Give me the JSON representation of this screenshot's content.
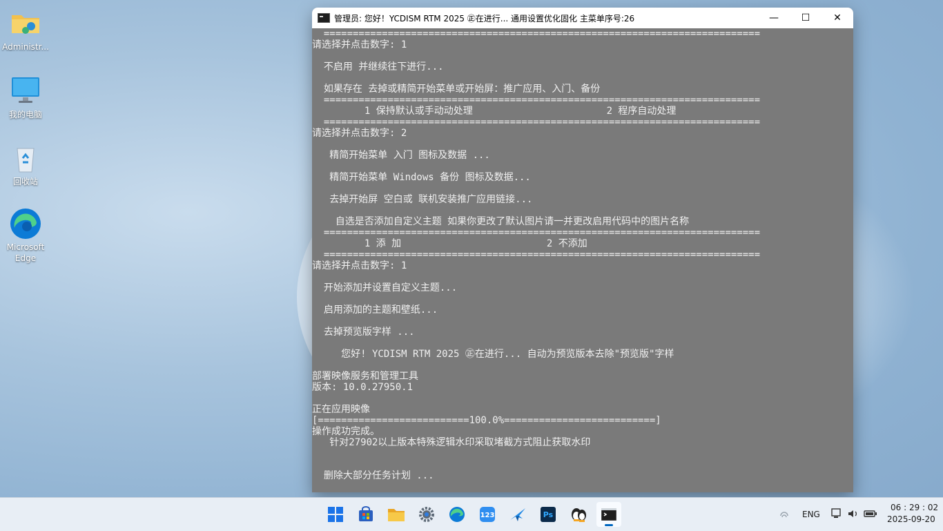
{
  "desktop": {
    "icons": [
      {
        "label": "Administr...",
        "icon": "user-folder-icon"
      },
      {
        "label": "我的电脑",
        "icon": "monitor-icon"
      },
      {
        "label": "回收站",
        "icon": "recycle-bin-icon"
      },
      {
        "label": "Microsoft Edge",
        "icon": "edge-icon"
      }
    ]
  },
  "window": {
    "title": "管理员:   您好！YCDISM RTM 2025 ㊣在进行... 通用设置优化固化  主菜单序号:26",
    "controls": {
      "minimize": "—",
      "maximize": "☐",
      "close": "✕"
    },
    "lines": [
      "  ===========================================================================",
      "请选择并点击数字: 1",
      "",
      "  不启用 并继续往下进行...",
      "",
      "  如果存在 去掉或精简开始菜单或开始屏：推广应用、入门、备份",
      "  ===========================================================================",
      "         1 保持默认或手动动处理                       2 程序自动处理",
      "  ===========================================================================",
      "请选择并点击数字: 2",
      "",
      "   精简开始菜单 入门 图标及数据 ...",
      "",
      "   精简开始菜单 Windows 备份 图标及数据...",
      "",
      "   去掉开始屏 空白或 联机安装推广应用链接...",
      "",
      "    自选是否添加自定义主题 如果你更改了默认图片请一并更改启用代码中的图片名称",
      "  ===========================================================================",
      "         1 添 加                         2 不添加",
      "  ===========================================================================",
      "请选择并点击数字: 1",
      "",
      "  开始添加并设置自定义主题...",
      "",
      "  启用添加的主题和壁纸...",
      "",
      "  去掉预览版字样 ...",
      "",
      "     您好! YCDISM RTM 2025 ㊣在进行... 自动为预览版本去除\"预览版\"字样",
      "",
      "部署映像服务和管理工具",
      "版本: 10.0.27950.1",
      "",
      "正在应用映像",
      "[==========================100.0%==========================]",
      "操作成功完成。",
      "   针对27902以上版本特殊逻辑水印采取堵截方式阻止获取水印",
      "",
      "",
      "  删除大部分任务计划 ..."
    ]
  },
  "taskbar": {
    "apps": [
      {
        "name": "windows-start-icon"
      },
      {
        "name": "store-icon"
      },
      {
        "name": "file-explorer-icon"
      },
      {
        "name": "settings-gear-icon"
      },
      {
        "name": "edge-icon"
      },
      {
        "name": "app-123-icon"
      },
      {
        "name": "feather-app-icon"
      },
      {
        "name": "photoshop-icon",
        "label": "Ps"
      },
      {
        "name": "qq-penguin-icon"
      },
      {
        "name": "terminal-icon"
      }
    ],
    "tray": {
      "lang": "ENG",
      "time": "06 : 29 : 02",
      "date": "2025-09-20"
    }
  }
}
